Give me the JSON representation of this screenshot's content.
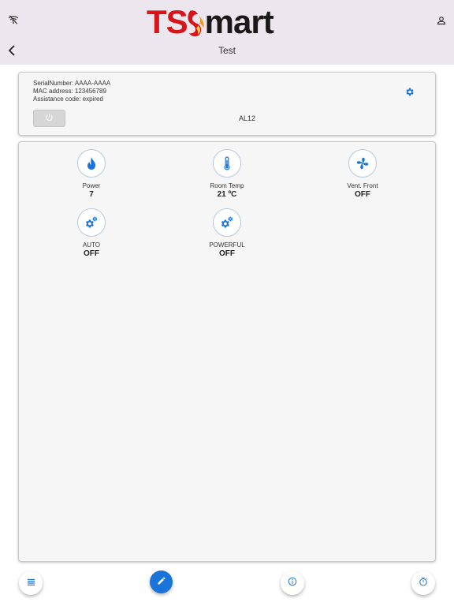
{
  "header": {
    "brand_left": "TS",
    "brand_right": "mart",
    "title": "Test"
  },
  "device": {
    "serial": "SerialNumber: AAAA-AAAA",
    "mac": "MAC address: 123456789",
    "assistance": "Assistance code: expired",
    "model": "AL12"
  },
  "tiles": [
    {
      "label": "Power",
      "value": "7",
      "icon": "flame-icon"
    },
    {
      "label": "Room Temp",
      "value": "21 ºC",
      "icon": "thermometer-icon"
    },
    {
      "label": "Vent. Front",
      "value": "OFF",
      "icon": "fan-icon"
    },
    {
      "label": "AUTO",
      "value": "OFF",
      "icon": "gears-icon"
    },
    {
      "label": "POWERFUL",
      "value": "OFF",
      "icon": "gears-icon"
    }
  ],
  "colors": {
    "accent": "#1a73d9",
    "brand_red": "#d8141b",
    "header_bg": "#ece6ee"
  }
}
